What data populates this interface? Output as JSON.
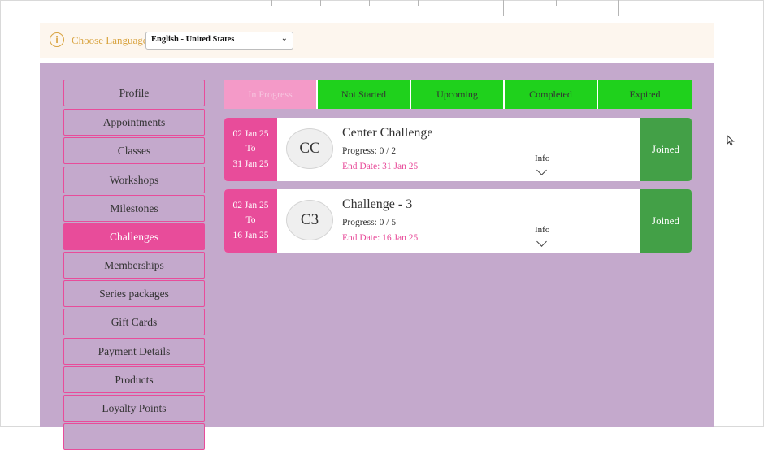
{
  "language": {
    "label": "Choose Language",
    "selected": "English - United States",
    "info_icon": "info-icon",
    "caret_glyph": "⌄"
  },
  "sidebar": {
    "items": [
      {
        "label": "Profile",
        "active": false
      },
      {
        "label": "Appointments",
        "active": false
      },
      {
        "label": "Classes",
        "active": false
      },
      {
        "label": "Workshops",
        "active": false
      },
      {
        "label": "Milestones",
        "active": false
      },
      {
        "label": "Challenges",
        "active": true
      },
      {
        "label": "Memberships",
        "active": false
      },
      {
        "label": "Series packages",
        "active": false
      },
      {
        "label": "Gift Cards",
        "active": false
      },
      {
        "label": "Payment Details",
        "active": false
      },
      {
        "label": "Products",
        "active": false
      },
      {
        "label": "Loyalty Points",
        "active": false
      }
    ]
  },
  "tabs": [
    {
      "label": "In Progress",
      "active": true
    },
    {
      "label": "Not Started",
      "active": false
    },
    {
      "label": "Upcoming",
      "active": false
    },
    {
      "label": "Completed",
      "active": false
    },
    {
      "label": "Expired",
      "active": false
    }
  ],
  "challenges": [
    {
      "start": "02 Jan 25",
      "to": "To",
      "end": "31 Jan 25",
      "initials": "CC",
      "title": "Center Challenge",
      "progress": "Progress: 0 / 2",
      "end_date": "End Date: 31 Jan 25",
      "info": "Info",
      "status": "Joined"
    },
    {
      "start": "02 Jan 25",
      "to": "To",
      "end": "16 Jan 25",
      "initials": "C3",
      "title": "Challenge - 3",
      "progress": "Progress: 0 / 5",
      "end_date": "End Date: 16 Jan 25",
      "info": "Info",
      "status": "Joined"
    }
  ],
  "colors": {
    "accent_pink": "#e84c9a",
    "panel_purple": "#c4a9cc",
    "tab_green": "#1fd11c",
    "joined_green": "#43a047",
    "language_orange": "#d9a441"
  }
}
